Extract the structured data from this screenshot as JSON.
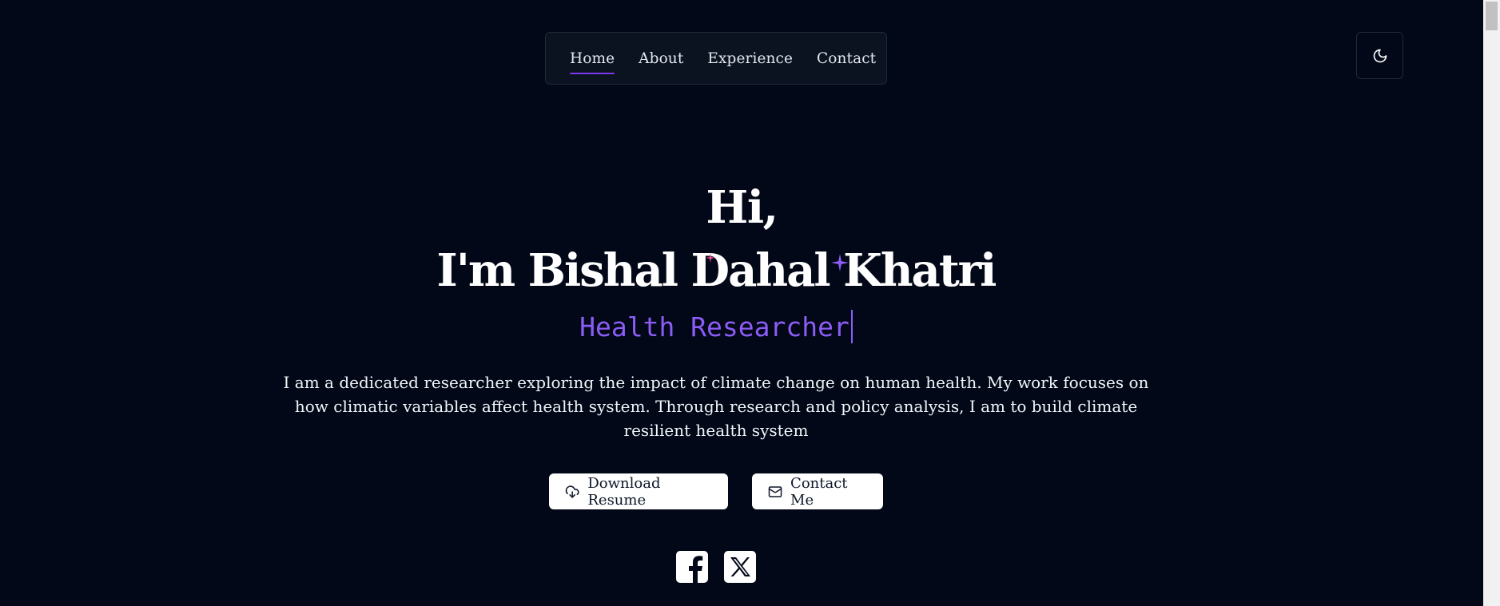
{
  "nav": {
    "items": [
      {
        "label": "Home",
        "active": true
      },
      {
        "label": "About",
        "active": false
      },
      {
        "label": "Experience",
        "active": false
      },
      {
        "label": "Contact",
        "active": false
      }
    ],
    "theme_toggle_icon": "moon-icon"
  },
  "hero": {
    "greeting": "Hi,",
    "name_line": "I'm Bishal Dahal Khatri",
    "role": "Health Researcher",
    "bio": "I am a dedicated researcher exploring the impact of climate change on human health. My work focuses on how climatic variables affect health system. Through research and policy analysis, I am to build climate resilient health system"
  },
  "buttons": {
    "download_label": "Download Resume",
    "download_icon": "cloud-download-icon",
    "contact_label": "Contact Me",
    "contact_icon": "mail-icon"
  },
  "socials": [
    {
      "icon": "facebook-icon"
    },
    {
      "icon": "x-twitter-icon"
    }
  ],
  "colors": {
    "background": "#020817",
    "accent": "#8b5cf6",
    "nav_underline": "#7c3aed",
    "text": "#f8fafc"
  }
}
